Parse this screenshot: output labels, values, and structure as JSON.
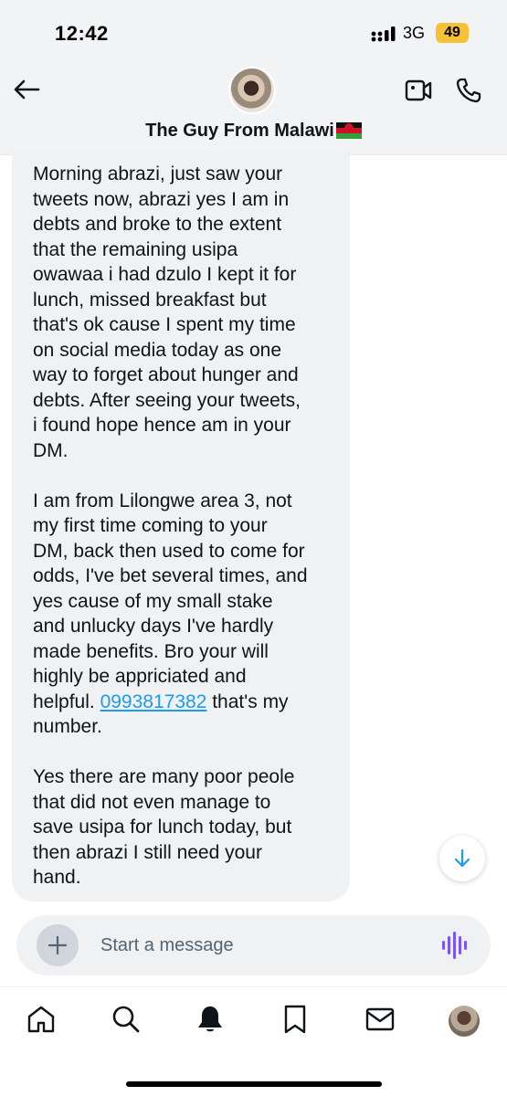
{
  "status_bar": {
    "time": "12:42",
    "network": "3G",
    "battery": "49"
  },
  "header": {
    "contact_name": "The Guy From Malawi",
    "icons": [
      "back-arrow-icon",
      "contact-avatar",
      "video-camera-icon",
      "phone-icon",
      "malawi-flag-icon"
    ]
  },
  "message": {
    "paragraph_1": "Morning abrazi, just saw your\ntweets now, abrazi yes I am in\ndebts and broke to the extent\nthat the remaining usipa\nowawaa i had dzulo I kept it for\nlunch, missed breakfast but\nthat's ok cause I spent my time\non social media today as one\nway to forget about hunger and\ndebts. After seeing your tweets,\ni found hope hence am in your\nDM.",
    "paragraph_2_before_link": "I am from Lilongwe area 3, not\nmy first time coming to your\nDM, back then used to come for\nodds, I've bet several times, and\nyes cause of my small stake\nand unlucky days I've hardly\nmade benefits. Bro your will\nhighly be appriciated and\nhelpful. ",
    "phone_number": "0993817382",
    "paragraph_2_after_link": " that's my\nnumber.",
    "paragraph_3": "Yes there are many poor peole\nthat did not even manage to\nsave usipa for lunch today, but\nthen abrazi I still need your\nhand."
  },
  "composer": {
    "placeholder": "Start a message"
  },
  "bottom_nav": {
    "items": [
      "home-icon",
      "search-icon",
      "notifications-bell-icon",
      "bookmark-icon",
      "messages-envelope-icon",
      "profile-avatar"
    ]
  },
  "colors": {
    "accent": "#1d9bf0",
    "voice_accent": "#7856ff",
    "bubble_bg": "#eff1f3",
    "battery": "#f6c234"
  }
}
